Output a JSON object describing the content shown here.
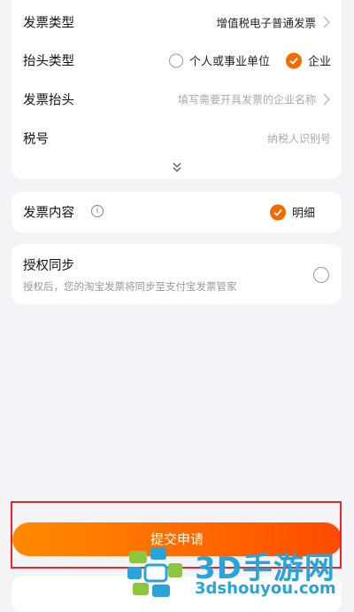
{
  "invoice_form": {
    "invoice_type": {
      "label": "发票类型",
      "value": "增值税电子普通发票"
    },
    "title_type": {
      "label": "抬头类型",
      "option_personal": "个人或事业单位",
      "option_company": "企业",
      "selected": "企业"
    },
    "invoice_title": {
      "label": "发票抬头",
      "placeholder": "填写需要开具发票的企业名称"
    },
    "tax_number": {
      "label": "税号",
      "placeholder": "纳税人识别号"
    }
  },
  "content": {
    "label": "发票内容",
    "option": "明细"
  },
  "authorization": {
    "title": "授权同步",
    "description": "授权后，您的淘宝发票将同步至支付宝发票管家"
  },
  "submit": {
    "label": "提交申请"
  },
  "watermark": {
    "brand": "3D手游网",
    "domain": "3dshouyou.com"
  },
  "colors": {
    "accent": "#f56a00",
    "frame": "#e8262c",
    "watermark": "#2aa3d8"
  }
}
